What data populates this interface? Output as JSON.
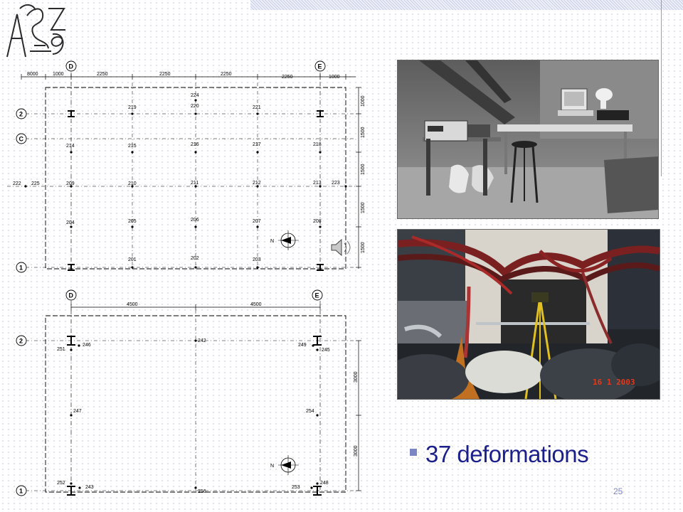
{
  "slide": {
    "bullet_text": "37 deformations",
    "page_number": "25"
  },
  "plan_top": {
    "axis_labels": {
      "col_d": "D",
      "col_e": "E",
      "row_2": "2",
      "row_c": "C",
      "row_1": "1"
    },
    "dimensions": [
      "8000",
      "1000",
      "2250",
      "2250",
      "2250",
      "2250",
      "1000"
    ],
    "side_dimensions": [
      "1000",
      "1500",
      "1500",
      "1500",
      "1500"
    ],
    "points": [
      "224",
      "219",
      "220",
      "221",
      "214",
      "215",
      "216",
      "217",
      "218",
      "222",
      "225",
      "209",
      "210",
      "211",
      "212",
      "213",
      "223",
      "204",
      "205",
      "206",
      "207",
      "208",
      "201",
      "202",
      "203"
    ],
    "north_label": "N"
  },
  "plan_bottom": {
    "axis_labels": {
      "col_d": "D",
      "col_e": "E",
      "row_2": "2",
      "row_1": "1"
    },
    "dimensions": [
      "4500",
      "4500"
    ],
    "side_dimensions": [
      "3000",
      "3000"
    ],
    "points": [
      "242",
      "246",
      "251",
      "249",
      "245",
      "247",
      "254",
      "252",
      "243",
      "256",
      "253",
      "248"
    ],
    "north_label": "N"
  },
  "photos": {
    "bottom_date_stamp": "16  1  2003"
  },
  "colors": {
    "accent": "#1b1f8c",
    "bullet": "#7c86c4",
    "date_stamp": "#e03a1e"
  },
  "icons": [
    "university-logo",
    "speaker-icon",
    "north-arrow-icon",
    "square-bullet"
  ]
}
